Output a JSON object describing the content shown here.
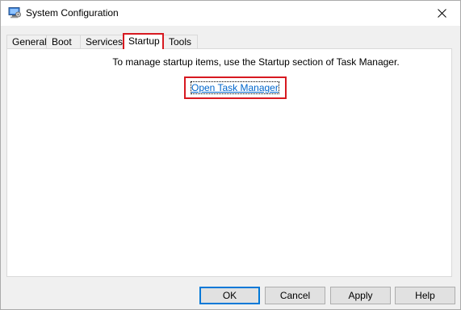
{
  "window": {
    "title": "System Configuration",
    "app_icon": "msconfig-icon",
    "close_icon": "close-icon"
  },
  "tabs": [
    {
      "label": "General",
      "selected": false
    },
    {
      "label": "Boot",
      "selected": false
    },
    {
      "label": "Services",
      "selected": false
    },
    {
      "label": "Startup",
      "selected": true
    },
    {
      "label": "Tools",
      "selected": false
    }
  ],
  "startup": {
    "description": "To manage startup items, use the Startup section of Task Manager.",
    "link_label": "Open Task Manager"
  },
  "buttons": {
    "ok": "OK",
    "cancel": "Cancel",
    "apply": "Apply",
    "help": "Help"
  },
  "colors": {
    "highlight": "#d71920",
    "link": "#0066cc",
    "default_button_border": "#0078d7"
  }
}
